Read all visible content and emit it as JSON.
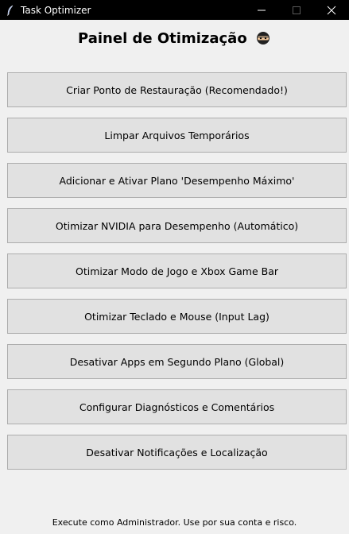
{
  "window": {
    "title": "Task Optimizer",
    "title_bar_color": "#000000",
    "app_icon": "feather-pen-icon",
    "controls": [
      "minimize-icon",
      "maximize-icon",
      "close-icon"
    ]
  },
  "main": {
    "heading": "Painel de Otimização",
    "heading_emoji": "ninja-face-icon",
    "buttons": [
      {
        "label": "Criar Ponto de Restauração (Recomendado!)"
      },
      {
        "label": "Limpar Arquivos Temporários"
      },
      {
        "label": "Adicionar e Ativar Plano 'Desempenho Máximo'"
      },
      {
        "label": "Otimizar NVIDIA para Desempenho (Automático)"
      },
      {
        "label": "Otimizar Modo de Jogo e Xbox Game Bar"
      },
      {
        "label": "Otimizar Teclado e Mouse (Input Lag)"
      },
      {
        "label": "Desativar Apps em Segundo Plano (Global)"
      },
      {
        "label": "Configurar Diagnósticos e Comentários"
      },
      {
        "label": "Desativar Notificações e Localização"
      }
    ]
  },
  "footer": {
    "text": "Execute como Administrador. Use por sua conta e risco."
  },
  "colors": {
    "background": "#f0f0f0",
    "button_face": "#e1e1e1",
    "button_border": "#adadad"
  }
}
